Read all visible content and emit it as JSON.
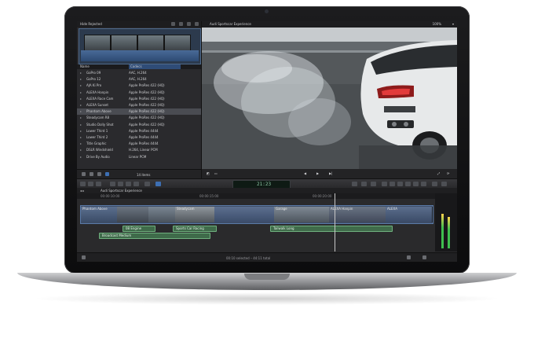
{
  "browser": {
    "header": "Hide Rejected",
    "columns": {
      "name": "Name",
      "codecs": "Codecs"
    },
    "clips": [
      {
        "name": "GoPro 09",
        "codec": "AAC, H.264",
        "selected": false
      },
      {
        "name": "GoPro 12",
        "codec": "AAC, H.264",
        "selected": false
      },
      {
        "name": "AJA Ki Pro",
        "codec": "Apple ProRes 422 (HQ)",
        "selected": false
      },
      {
        "name": "ALEXA Hanpin",
        "codec": "Apple ProRes 422 (HQ)",
        "selected": false
      },
      {
        "name": "ALEXA Race Cam",
        "codec": "Apple ProRes 422 (HQ)",
        "selected": false
      },
      {
        "name": "ALEXA Sunset",
        "codec": "Apple ProRes 422 (HQ)",
        "selected": false
      },
      {
        "name": "Phantom Above",
        "codec": "Apple ProRes 422 (HQ)",
        "selected": true
      },
      {
        "name": "Steadycam R8",
        "codec": "Apple ProRes 422 (HQ)",
        "selected": false
      },
      {
        "name": "Studio Dolly Shot",
        "codec": "Apple ProRes 422 (HQ)",
        "selected": false
      },
      {
        "name": "Lower Third 1",
        "codec": "Apple ProRes 4444",
        "selected": false
      },
      {
        "name": "Lower Third 2",
        "codec": "Apple ProRes 4444",
        "selected": false
      },
      {
        "name": "Title Graphic",
        "codec": "Apple ProRes 4444",
        "selected": false
      },
      {
        "name": "DSLR Windshield",
        "codec": "H.264, Linear PCM",
        "selected": false
      },
      {
        "name": "Drive By Audio",
        "codec": "Linear PCM",
        "selected": false
      }
    ],
    "item_count": "14 items"
  },
  "viewer": {
    "title": "Audi Sportscar Experience",
    "zoom": "100%"
  },
  "toolbar": {
    "timecode": "21:23"
  },
  "timeline": {
    "project": "Audi Sportscar Experience",
    "ruler": [
      "00:00:10:00",
      "00:00:15:00",
      "00:00:20:00"
    ],
    "clips": [
      {
        "label": "Phantom Above"
      },
      {
        "label": ""
      },
      {
        "label": ""
      },
      {
        "label": "Steadycam"
      },
      {
        "label": ""
      },
      {
        "label": "Garage"
      },
      {
        "label": "ALEXA Hanpin"
      },
      {
        "label": "ALEXA"
      }
    ],
    "audio": [
      {
        "label": "08 Engine"
      },
      {
        "label": "Sports Car Racing"
      },
      {
        "label": "Tailwalk Long"
      },
      {
        "label": "Broadcast Medium"
      }
    ],
    "status": "00:10 selected – 44:11 total"
  },
  "colors": {
    "selection_blue": "#3d6fb3",
    "audio_green": "#3f6b4a",
    "timecode_green": "#8fc9a8"
  }
}
